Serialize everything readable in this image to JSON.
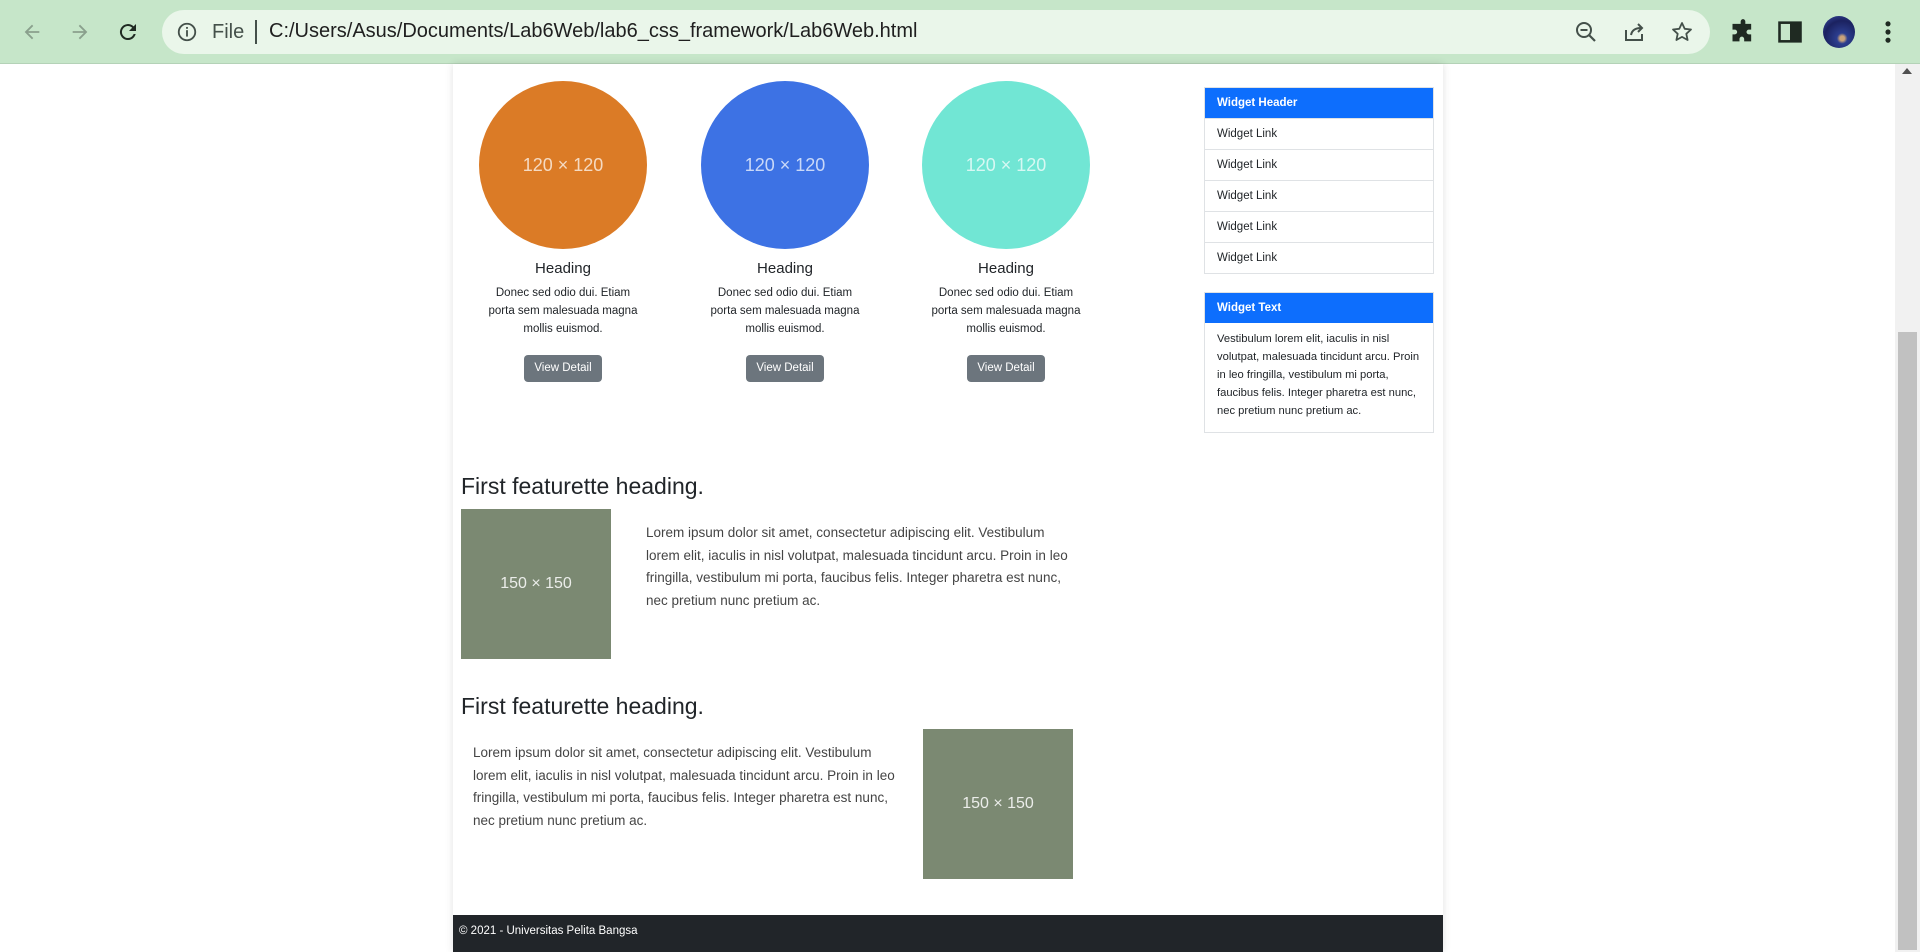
{
  "browser": {
    "file_label": "File",
    "url": "C:/Users/Asus/Documents/Lab6Web/lab6_css_framework/Lab6Web.html"
  },
  "cards": [
    {
      "placeholder": "120 × 120",
      "color": "#db7b26",
      "heading": "Heading",
      "text": "Donec sed odio dui. Etiam porta sem malesuada magna mollis euismod.",
      "button": "View Detail"
    },
    {
      "placeholder": "120 × 120",
      "color": "#3d72e4",
      "heading": "Heading",
      "text": "Donec sed odio dui. Etiam porta sem malesuada magna mollis euismod.",
      "button": "View Detail"
    },
    {
      "placeholder": "120 × 120",
      "color": "#71e6d4",
      "heading": "Heading",
      "text": "Donec sed odio dui. Etiam porta sem malesuada magna mollis euismod.",
      "button": "View Detail"
    }
  ],
  "featurettes": [
    {
      "heading": "First featurette heading.",
      "image": "150 × 150",
      "text": "Lorem ipsum dolor sit amet, consectetur adipiscing elit. Vestibulum lorem elit, iaculis in nisl volutpat, malesuada tincidunt arcu. Proin in leo fringilla, vestibulum mi porta, faucibus felis. Integer pharetra est nunc, nec pretium nunc pretium ac."
    },
    {
      "heading": "First featurette heading.",
      "image": "150 × 150",
      "text": "Lorem ipsum dolor sit amet, consectetur adipiscing elit. Vestibulum lorem elit, iaculis in nisl volutpat, malesuada tincidunt arcu. Proin in leo fringilla, vestibulum mi porta, faucibus felis. Integer pharetra est nunc, nec pretium nunc pretium ac."
    }
  ],
  "sidebar": {
    "links_widget": {
      "header": "Widget Header",
      "links": [
        "Widget Link",
        "Widget Link",
        "Widget Link",
        "Widget Link",
        "Widget Link"
      ]
    },
    "text_widget": {
      "header": "Widget Text",
      "body": "Vestibulum lorem elit, iaculis in nisl volutpat, malesuada tincidunt arcu. Proin in leo fringilla, vestibulum mi porta, faucibus felis. Integer pharetra est nunc, nec pretium nunc pretium ac."
    }
  },
  "footer": {
    "text": "© 2021 - Universitas Pelita Bangsa"
  },
  "colors": {
    "primary": "#0d6efd",
    "secondary": "#6c757d",
    "dark": "#212529",
    "placeholder_gray": "#7b8972"
  }
}
